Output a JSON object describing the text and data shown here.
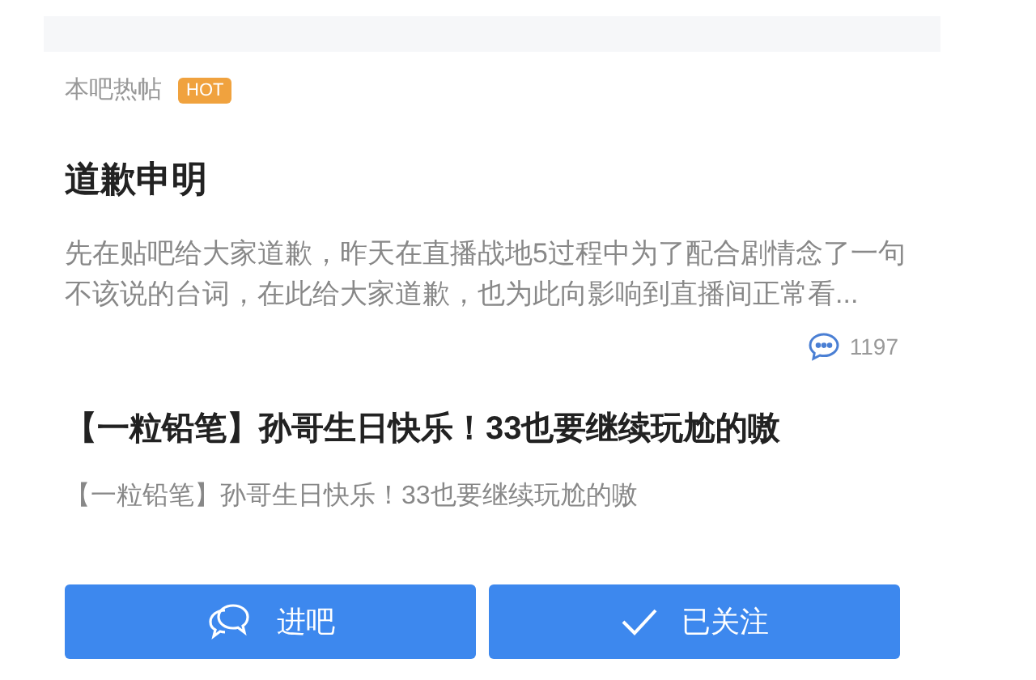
{
  "section": {
    "title": "本吧热帖",
    "badge": "HOT"
  },
  "posts": [
    {
      "title": "道歉申明",
      "excerpt": "先在贴吧给大家道歉，昨天在直播战地5过程中为了配合剧情念了一句不该说的台词，在此给大家道歉，也为此向影响到直播间正常看...",
      "comments": "1197"
    },
    {
      "title": "【一粒铅笔】孙哥生日快乐！33也要继续玩尬的嗷",
      "excerpt": "【一粒铅笔】孙哥生日快乐！33也要继续玩尬的嗷"
    }
  ],
  "buttons": [
    {
      "kind": "enter",
      "label": "进吧"
    },
    {
      "kind": "followed",
      "label": "已关注"
    }
  ]
}
